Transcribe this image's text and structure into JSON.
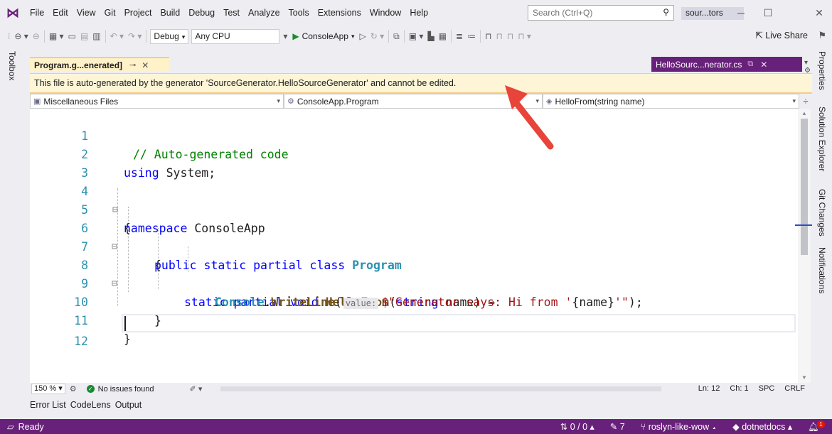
{
  "menu": {
    "items": [
      "File",
      "Edit",
      "View",
      "Git",
      "Project",
      "Build",
      "Debug",
      "Test",
      "Analyze",
      "Tools",
      "Extensions",
      "Window",
      "Help"
    ],
    "search_placeholder": "Search (Ctrl+Q)",
    "solution_name": "sour...tors"
  },
  "toolbar": {
    "config": "Debug",
    "platform": "Any CPU",
    "start_label": "ConsoleApp",
    "live_share": "Live Share"
  },
  "sidebar": {
    "toolbox": "Toolbox"
  },
  "right_rail": {
    "tabs": [
      "Properties",
      "Solution Explorer",
      "Git Changes",
      "Notifications"
    ]
  },
  "tabs": {
    "active": "Program.g...enerated]",
    "preview": "HelloSourc...nerator.cs"
  },
  "infobar": {
    "message": "This file is auto-generated by the generator 'SourceGenerator.HelloSourceGenerator' and cannot be edited."
  },
  "navbar": {
    "project": "Miscellaneous Files",
    "type": "ConsoleApp.Program",
    "member": "HelloFrom(string name)"
  },
  "editor": {
    "line_numbers": [
      "1",
      "2",
      "3",
      "4",
      "5",
      "6",
      "7",
      "8",
      "9",
      "10",
      "11",
      "12"
    ],
    "l1": "// Auto-generated code",
    "l2_kw": "using",
    "l2_rest": " System;",
    "l4_kw": "namespace",
    "l4_rest": " ConsoleApp",
    "l5": "{",
    "l6_kw": "public static partial class",
    "l6_type": "Program",
    "l7": "{",
    "l8_kw": "static partial void",
    "l8_method": "HelloFrom",
    "l8_open": "(",
    "l8_kw2": "string",
    "l8_rest": " name) ⇒",
    "l9_type": "Console",
    "l9_dot": ".",
    "l9_method": "WriteLine",
    "l9_open": "(",
    "l9_hint": "value:",
    "l9_str1": "$\"Generator says: Hi from '",
    "l9_interp": "{name}",
    "l9_str2": "'\"",
    "l9_end": ");",
    "l10": "}",
    "l11": "}"
  },
  "editor_status": {
    "zoom": "150 %",
    "issues": "No issues found",
    "line": "Ln: 12",
    "col": "Ch: 1",
    "spc": "SPC",
    "crlf": "CRLF"
  },
  "bottom_tabs": [
    "Error List",
    "CodeLens",
    "Output"
  ],
  "statusbar": {
    "ready": "Ready",
    "changes": "0 / 0",
    "pending": "7",
    "branch": "roslyn-like-wow",
    "repo": "dotnetdocs",
    "notifications": "1"
  },
  "colors": {
    "accent": "#68217a",
    "infobar_bg": "#fdf5d6",
    "annotation_arrow": "#e8443a"
  }
}
